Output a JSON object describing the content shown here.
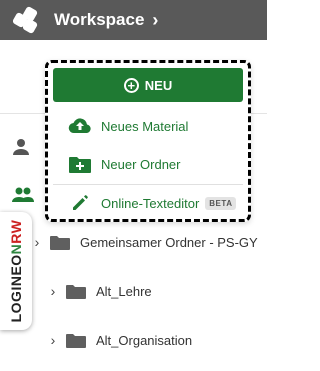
{
  "topbar": {
    "title": "Workspace",
    "chevron": "›"
  },
  "sidenav": {
    "icons": [
      "user-icon",
      "group-icon"
    ]
  },
  "logineo": {
    "part1": "LOGINEO",
    "part2": "N",
    "part3": "RW"
  },
  "menu": {
    "new_label": "NEU",
    "items": [
      {
        "label": "Neues Material",
        "icon": "cloud-upload-icon"
      },
      {
        "label": "Neuer Ordner",
        "icon": "folder-add-icon"
      },
      {
        "label": "Online-Texteditor",
        "icon": "pencil-icon",
        "badge": "BETA"
      }
    ]
  },
  "tree": {
    "items": [
      {
        "label": "Gemeinsamer Ordner - PS-GY"
      },
      {
        "label": "Alt_Lehre"
      },
      {
        "label": "Alt_Organisation"
      }
    ]
  },
  "colors": {
    "topbar": "#595959",
    "accent": "#1f7a33"
  }
}
